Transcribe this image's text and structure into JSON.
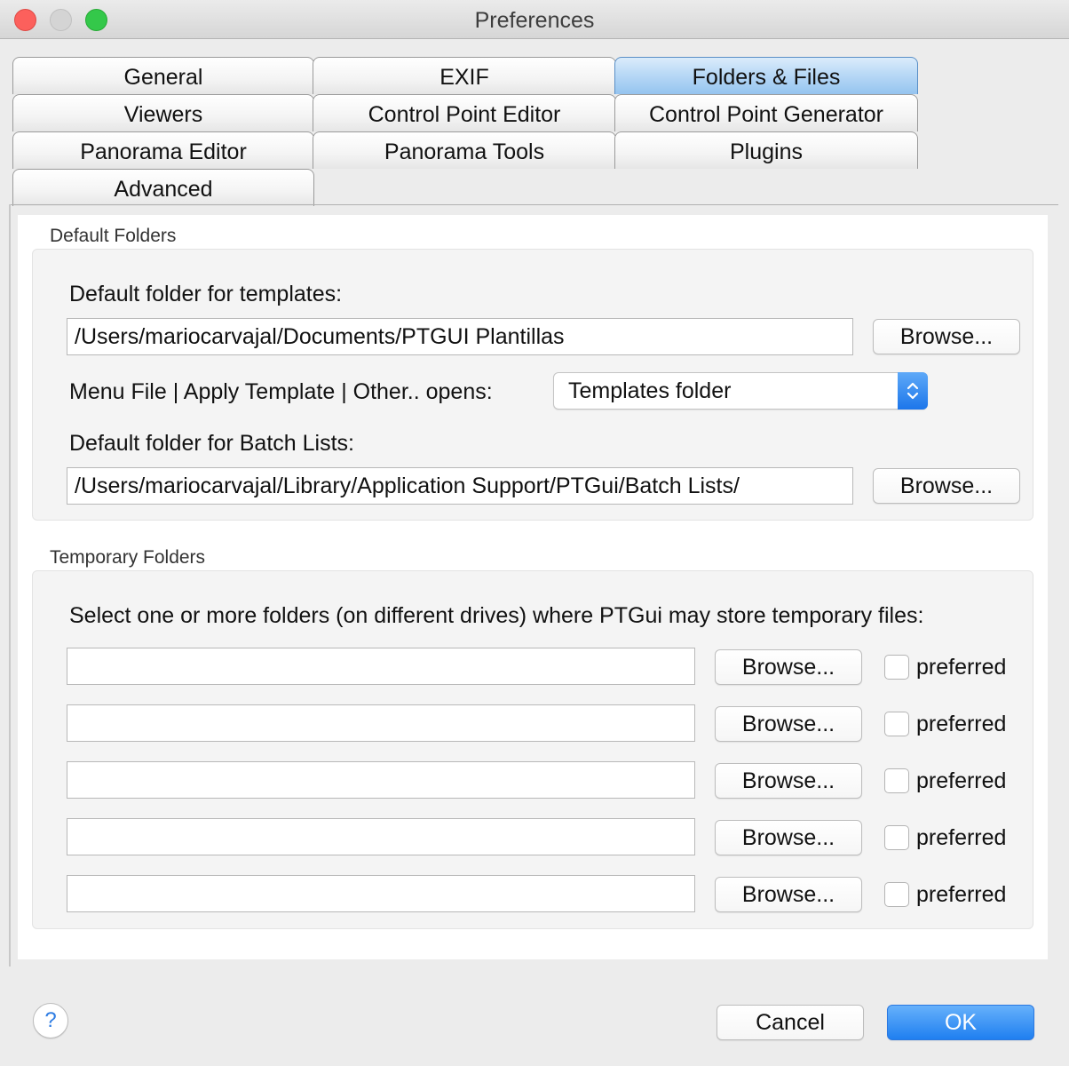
{
  "window": {
    "title": "Preferences"
  },
  "tabs": [
    {
      "label": "General",
      "active": false
    },
    {
      "label": "EXIF",
      "active": false
    },
    {
      "label": "Folders & Files",
      "active": true
    },
    {
      "label": "Viewers",
      "active": false
    },
    {
      "label": "Control Point Editor",
      "active": false
    },
    {
      "label": "Control Point Generator",
      "active": false
    },
    {
      "label": "Panorama Editor",
      "active": false
    },
    {
      "label": "Panorama Tools",
      "active": false
    },
    {
      "label": "Plugins",
      "active": false
    },
    {
      "label": "Advanced",
      "active": false
    }
  ],
  "default_folders": {
    "title": "Default Folders",
    "templates_label": "Default folder for templates:",
    "templates_path": "/Users/mariocarvajal/Documents/PTGUI Plantillas",
    "browse_label": "Browse...",
    "menu_label": "Menu File | Apply Template | Other.. opens:",
    "menu_value": "Templates folder",
    "batch_label": "Default folder for Batch Lists:",
    "batch_path": "/Users/mariocarvajal/Library/Application Support/PTGui/Batch Lists/"
  },
  "temporary_folders": {
    "title": "Temporary Folders",
    "description": "Select one or more folders (on different drives) where PTGui may store temporary files:",
    "browse_label": "Browse...",
    "preferred_label": "preferred",
    "rows": [
      {
        "path": "",
        "preferred": false
      },
      {
        "path": "",
        "preferred": false
      },
      {
        "path": "",
        "preferred": false
      },
      {
        "path": "",
        "preferred": false
      },
      {
        "path": "",
        "preferred": false
      }
    ]
  },
  "footer": {
    "help_glyph": "?",
    "cancel_label": "Cancel",
    "ok_label": "OK"
  },
  "colors": {
    "accent": "#1f7ff0",
    "active_tab": "#b9d9f6",
    "close": "#fc605c",
    "maximize": "#34c84a"
  }
}
